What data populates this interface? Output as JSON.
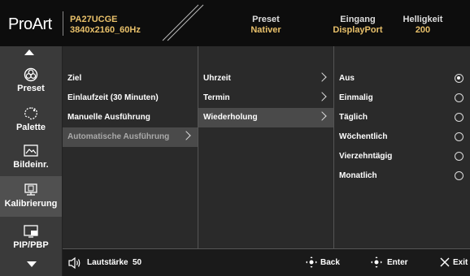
{
  "header": {
    "brand": "ProArt",
    "model_line1": "PA27UCGE",
    "model_line2": "3840x2160_60Hz",
    "preset_label": "Preset",
    "preset_value": "Nativer",
    "input_label": "Eingang",
    "input_value": "DisplayPort",
    "brightness_label": "Helligkeit",
    "brightness_value": "200"
  },
  "sidebar": {
    "items": [
      {
        "label": "Preset",
        "icon": "preset-icon"
      },
      {
        "label": "Palette",
        "icon": "palette-icon"
      },
      {
        "label": "Bildeinr.",
        "icon": "image-setup-icon"
      },
      {
        "label": "Kalibrierung",
        "icon": "calibration-icon"
      },
      {
        "label": "PIP/PBP",
        "icon": "pip-icon"
      }
    ]
  },
  "menu1": {
    "items": [
      {
        "label": "Ziel"
      },
      {
        "label": "Einlaufzeit (30 Minuten)"
      },
      {
        "label": "Manuelle Ausführung"
      },
      {
        "label": "Automatische Ausführung"
      }
    ]
  },
  "menu2": {
    "items": [
      {
        "label": "Uhrzeit"
      },
      {
        "label": "Termin"
      },
      {
        "label": "Wiederholung"
      }
    ]
  },
  "menu3": {
    "items": [
      {
        "label": "Aus",
        "selected": true
      },
      {
        "label": "Einmalig",
        "selected": false
      },
      {
        "label": "Täglich",
        "selected": false
      },
      {
        "label": "Wöchentlich",
        "selected": false
      },
      {
        "label": "Vierzehntägig",
        "selected": false
      },
      {
        "label": "Monatlich",
        "selected": false
      }
    ]
  },
  "footer": {
    "volume_label": "Lautstärke",
    "volume_value": "50",
    "back_label": "Back",
    "enter_label": "Enter",
    "exit_label": "Exit"
  },
  "colors": {
    "accent": "#e8c06a",
    "background": "#2a2a2a"
  }
}
